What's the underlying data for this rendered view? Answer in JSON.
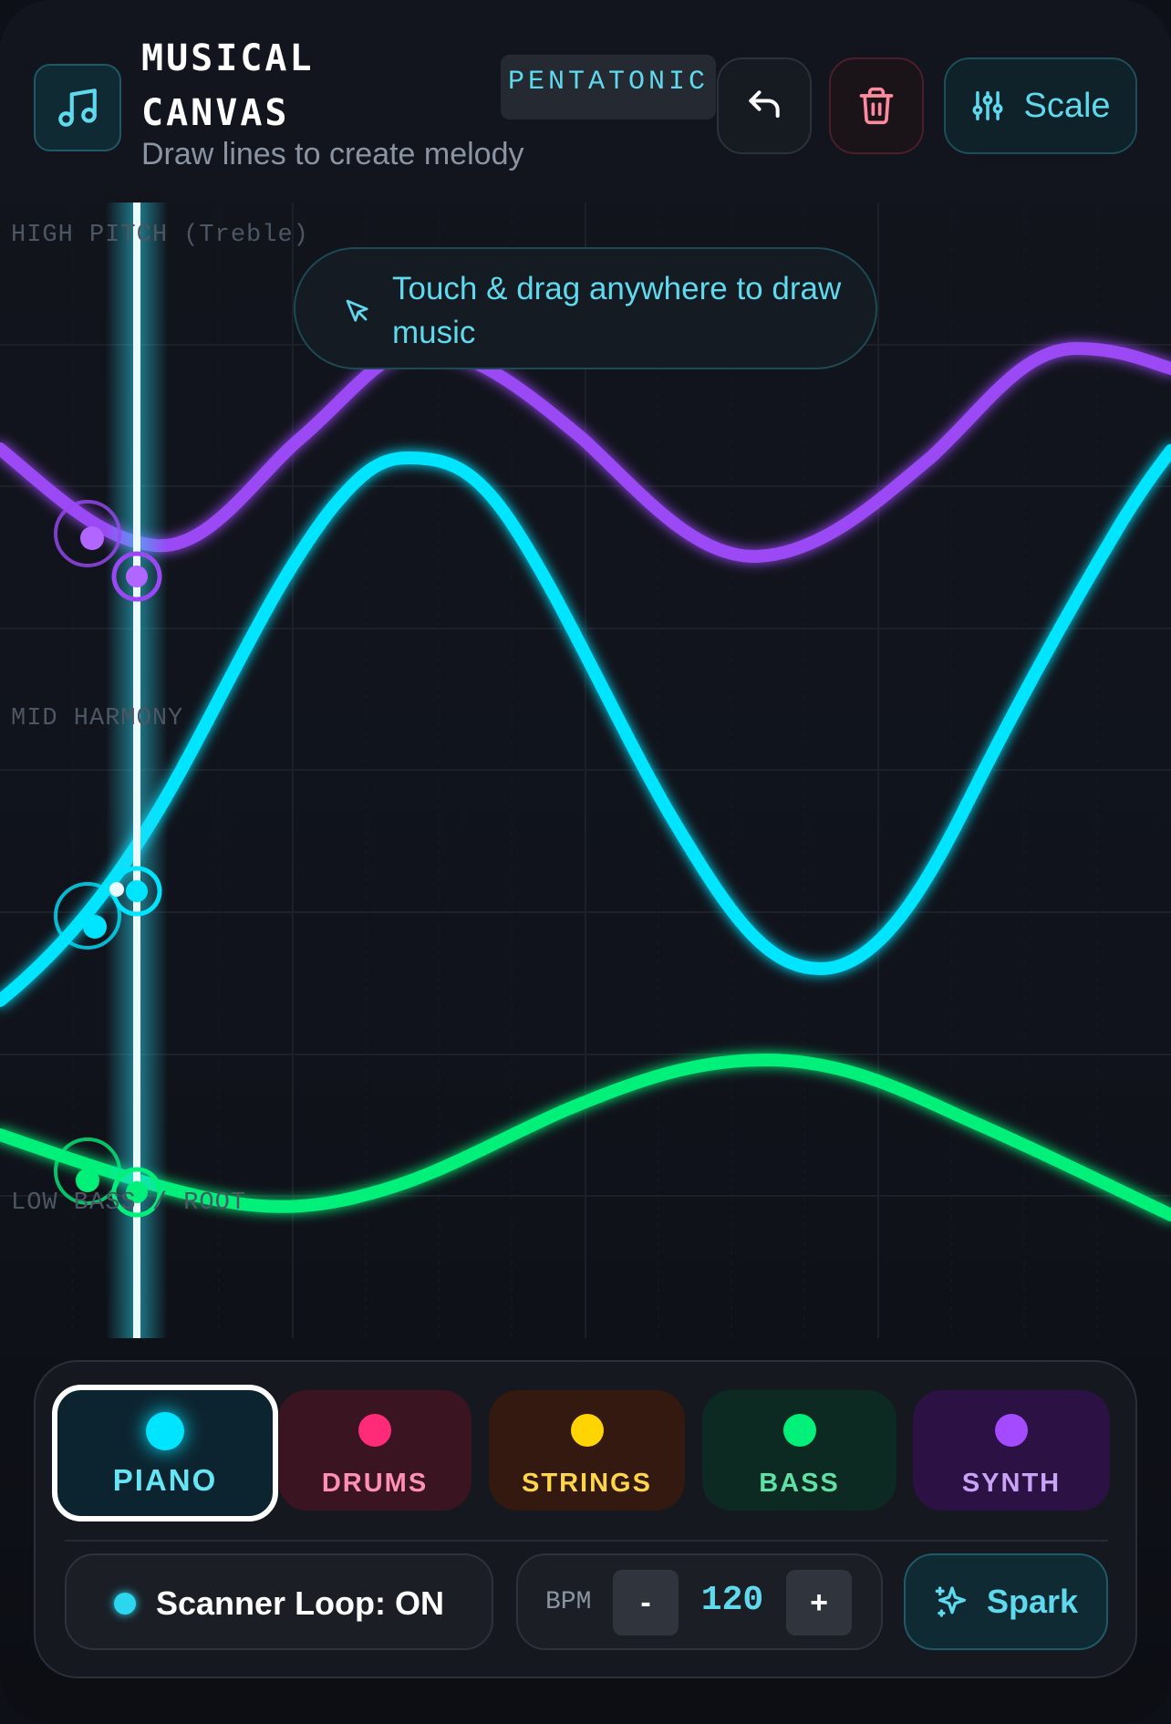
{
  "header": {
    "title_line1": "MUSICAL",
    "title_line2": "CANVAS",
    "subtitle": "Draw lines to create melody",
    "scale_badge": "PENTATONIC",
    "logo_icon": "music-note-icon",
    "undo_icon": "undo-icon",
    "trash_icon": "trash-icon",
    "scale_icon": "sliders-icon",
    "scale_label": "Scale"
  },
  "canvas": {
    "zones": {
      "high": "HIGH PITCH (Treble)",
      "mid": "MID HARMONY",
      "low": "LOW BASS / ROOT"
    },
    "hint": "Touch & drag anywhere to draw music",
    "hint_icon": "pointer-icon",
    "lines": [
      {
        "instrument": "synth",
        "color": "#a44bff"
      },
      {
        "instrument": "piano",
        "color": "#00e5ff"
      },
      {
        "instrument": "bass",
        "color": "#00f07a"
      }
    ],
    "scanner_color": "#2dd6ef"
  },
  "instruments": [
    {
      "label": "PIANO",
      "color": "#00e5ff",
      "selected": true
    },
    {
      "label": "DRUMS",
      "color": "#ff2a78",
      "selected": false
    },
    {
      "label": "STRINGS",
      "color": "#ffd400",
      "selected": false
    },
    {
      "label": "BASS",
      "color": "#00f07a",
      "selected": false
    },
    {
      "label": "SYNTH",
      "color": "#a44bff",
      "selected": false
    }
  ],
  "controls": {
    "loop_label": "Scanner Loop: ON",
    "bpm_label": "BPM",
    "bpm_minus": "-",
    "bpm_value": "120",
    "bpm_plus": "+",
    "spark_label": "Spark",
    "spark_icon": "sparkles-icon"
  }
}
